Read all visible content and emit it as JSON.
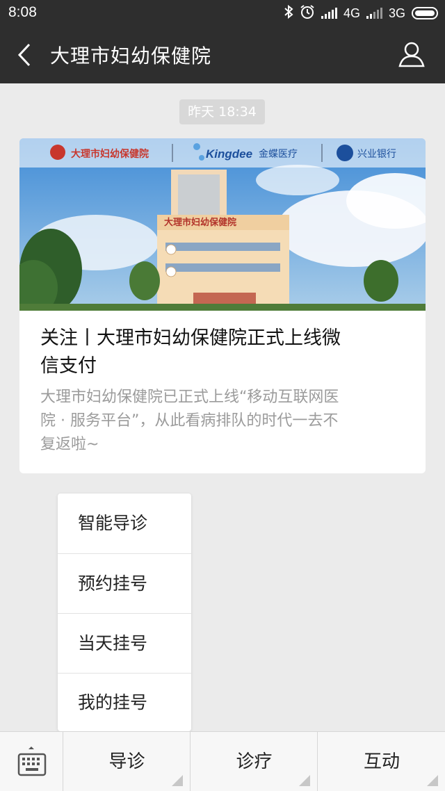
{
  "status_bar": {
    "time": "8:08",
    "network_1": "4G",
    "network_2": "3G"
  },
  "header": {
    "title": "大理市妇幼保健院"
  },
  "chat": {
    "timestamp": "昨天 18:34"
  },
  "article": {
    "cover_logo_hospital": "大理市妇幼保健院",
    "cover_logo_kingdee": "Kingdee",
    "cover_logo_kingdee_cn": "金蝶医疗",
    "cover_logo_bank": "兴业银行",
    "cover_building_sign": "大理市妇幼保健院",
    "headline": "关注丨大理市妇幼保健院正式上线微信支付",
    "summary": "大理市妇幼保健院已正式上线“移动互联网医院 · 服务平台”，从此看病排队的时代一去不复返啦~"
  },
  "popup_menu": {
    "items": [
      {
        "label": "智能导诊"
      },
      {
        "label": "预约挂号"
      },
      {
        "label": "当天挂号"
      },
      {
        "label": "我的挂号"
      }
    ]
  },
  "bottom_menu": {
    "tabs": [
      {
        "label": "导诊"
      },
      {
        "label": "诊疗"
      },
      {
        "label": "互动"
      }
    ]
  },
  "colors": {
    "bar_dark": "#2e2e2e",
    "background": "#ebebeb",
    "text_muted": "#9b9b9b"
  },
  "icons": [
    "bluetooth-icon",
    "alarm-icon",
    "signal-icon",
    "battery-icon",
    "back-arrow-icon",
    "profile-icon",
    "keyboard-icon"
  ]
}
